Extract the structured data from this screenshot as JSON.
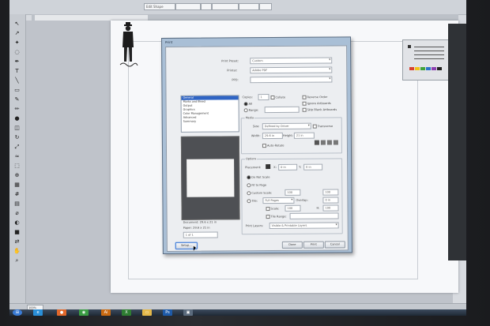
{
  "options_bar": {
    "fields": [
      "Edit Shape",
      "",
      "",
      "",
      "",
      ""
    ],
    "title_field": ""
  },
  "tab": {
    "label": ""
  },
  "status": {
    "zoom": "100%"
  },
  "dialog": {
    "title": "Print",
    "categories": [
      {
        "label": "General",
        "selected": true
      },
      {
        "label": "Marks and Bleed",
        "selected": false
      },
      {
        "label": "Output",
        "selected": false
      },
      {
        "label": "Graphics",
        "selected": false
      },
      {
        "label": "Color Management",
        "selected": false
      },
      {
        "label": "Advanced",
        "selected": false
      },
      {
        "label": "Summary",
        "selected": false
      }
    ],
    "preview_info": {
      "document": "Document: 29.6 x 21 in",
      "paper": "Paper: 29.6 x 21 in",
      "page_nav": "1 of 1"
    },
    "top_fields": {
      "preset_label": "Print Preset:",
      "preset_value": "Custom",
      "printer_label": "Printer:",
      "printer_value": "Adobe PDF",
      "ppd_label": "PPD:",
      "ppd_value": ""
    },
    "copies_label": "Copies:",
    "copies_value": "1",
    "collate_label": "Collate",
    "reverse_label": "Reverse Order",
    "ignore_label": "Ignore Artboards",
    "skip_label": "Skip Blank Artboards",
    "range_label": "Range:",
    "all_label": "All",
    "media": {
      "group_label": "Media",
      "size_label": "Size:",
      "size_value": "Defined by Driver",
      "transverse_label": "Transverse",
      "width_label": "Width:",
      "width_value": "29.6 in",
      "height_label": "Height:",
      "height_value": "21 in",
      "auto_label": "Auto-Rotate"
    },
    "options": {
      "group_label": "Options",
      "placement_label": "Placement:",
      "x_label": "X:",
      "x_value": "0 in",
      "y_label": "Y:",
      "y_value": "0 in",
      "do_not_scale": "Do Not Scale",
      "fit_to_page": "Fit to Page",
      "custom_scale": "Custom Scale:",
      "tile": "Tile:",
      "tile_value": "Full Pages",
      "scale_w": "100",
      "scale_h": "100",
      "overlap_label": "Overlap:",
      "overlap_value": "0 in",
      "scale_label": "Scale:",
      "scale_value": "100",
      "h_label": "H:",
      "tile_range": "Tile Range:",
      "print_layers_label": "Print Layers:",
      "print_layers_value": "Visible & Printable Layers"
    },
    "buttons": {
      "setup": "Setup...",
      "done": "Done",
      "print": "Print",
      "cancel": "Cancel"
    }
  },
  "taskbar_icons": [
    "start-icon",
    "ie-icon",
    "firefox-icon",
    "chrome-icon",
    "illustrator-icon",
    "excel-icon",
    "file-explorer-icon",
    "photoshop-icon",
    "misc-icon"
  ],
  "colors": {
    "dialog_frame": "#a9bfd6",
    "selection": "#2f64c4",
    "artboard": "#f7f8fa"
  }
}
